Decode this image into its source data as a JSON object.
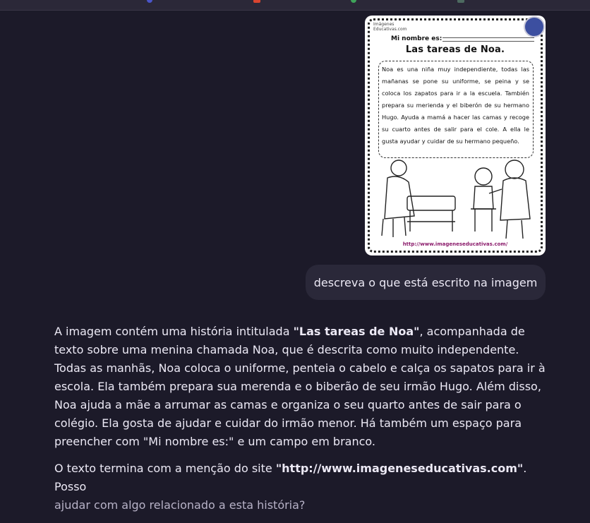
{
  "topbar": {},
  "user_message": {
    "image": {
      "brand_line1": "Imágenes",
      "brand_line2": "Educativas.com",
      "name_label": "Mi nombre es:",
      "title": "Las tareas de Noa.",
      "story": "Noa es una niña muy independiente, todas las mañanas se pone su uniforme, se peina y se coloca los zapatos para ir a la escuela. También prepara su merienda y el biberón de su hermano Hugo. Ayuda a mamá a hacer las camas y recoge su cuarto antes de salir para el cole. A ella le gusta ayudar y cuidar de su hermano pequeño.",
      "footer_url": "http://www.imageneseducativas.com/"
    },
    "text": "descreva o que está escrito na imagem"
  },
  "assistant_message": {
    "p1_intro": "A imagem contém uma história intitulada ",
    "p1_title": "\"Las tareas de Noa\"",
    "p1_rest": ", acompanhada de texto sobre uma menina chamada Noa, que é descrita como muito independente. Todas as manhãs, Noa coloca o uniforme, penteia o cabelo e calça os sapatos para ir à escola. Ela também prepara sua merenda e o biberão de seu irmão Hugo. Além disso, Noa ajuda a mãe a arrumar as camas e organiza o seu quarto antes de sair para o colégio. Ela gosta de ajudar e cuidar do irmão menor. Há também um espaço para preencher com \"Mi nombre es:\" e um campo em branco.",
    "p2_intro": "O texto termina com a menção do site ",
    "p2_url": "\"http://www.imageneseducativas.com\"",
    "p2_mid": ". Posso",
    "p2_end": "ajudar com algo relacionado a esta história?"
  }
}
